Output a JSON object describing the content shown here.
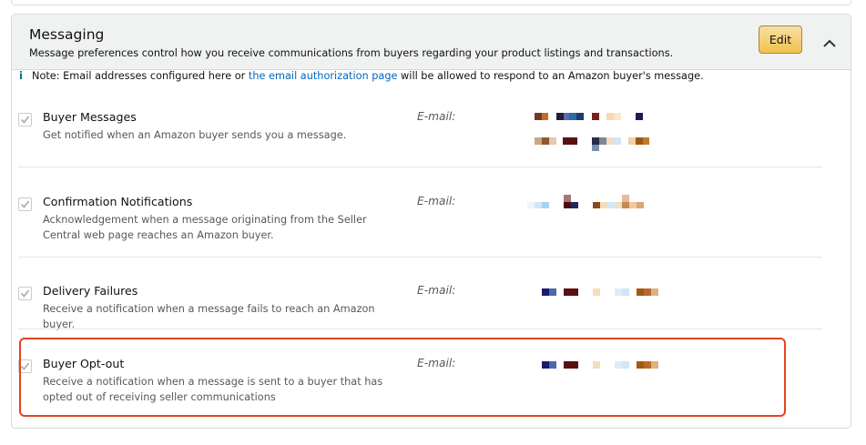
{
  "section": {
    "title": "Messaging",
    "subtitle": "Message preferences control how you receive communications from buyers regarding your product listings and transactions.",
    "edit_label": "Edit",
    "collapse_icon": "chevron-up-icon"
  },
  "note": {
    "icon": "i",
    "prefix": "Note: Email addresses configured here or ",
    "link": "the email authorization page",
    "suffix": " will be allowed to respond to an Amazon buyer's message."
  },
  "preferences": [
    {
      "name": "Buyer Messages",
      "description": "Get notified when an Amazon buyer sends you a message.",
      "checked": true,
      "email_label": "E-mail:",
      "email_redacted": true
    },
    {
      "name": "Confirmation Notifications",
      "description": "Acknowledgement when a message originating from the Seller Central web page reaches an Amazon buyer.",
      "checked": true,
      "email_label": "E-mail:",
      "email_redacted": true
    },
    {
      "name": "Delivery Failures",
      "description": "Receive a notification when a message fails to reach an Amazon buyer.",
      "checked": true,
      "email_label": "E-mail:",
      "email_redacted": true
    },
    {
      "name": "Buyer Opt-out",
      "description": "Receive a notification when a message is sent to a buyer that has opted out of receiving seller communications",
      "checked": true,
      "email_label": "E-mail:",
      "email_redacted": true,
      "highlighted": true
    }
  ],
  "colors": {
    "highlight_border": "#e3441c",
    "link": "#0066c0",
    "edit_button": "#f0c14b",
    "header_background": "#f0f2f2"
  }
}
